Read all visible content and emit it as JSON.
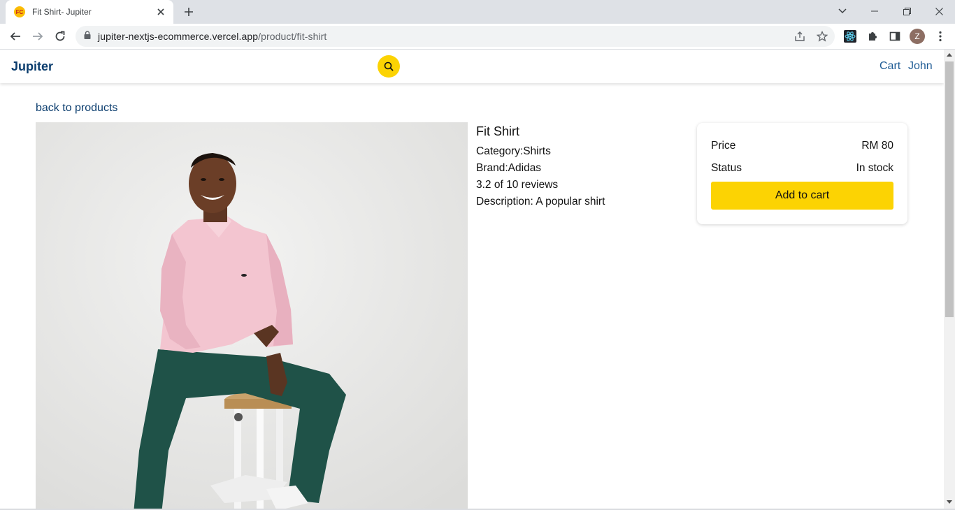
{
  "browser": {
    "tab": {
      "favicon_text": "FC",
      "title": "Fit Shirt- Jupiter"
    },
    "address": {
      "domain": "jupiter-nextjs-ecommerce.vercel.app",
      "path": "/product/fit-shirt"
    },
    "profile_initial": "Z"
  },
  "header": {
    "brand": "Jupiter",
    "cart_label": "Cart",
    "user_label": "John"
  },
  "product": {
    "back_label": "back to products",
    "name": "Fit Shirt",
    "category": "Category:Shirts",
    "brand": "Brand:Adidas",
    "reviews": "3.2 of 10 reviews",
    "description": "Description: A popular shirt"
  },
  "purchase": {
    "price_label": "Price",
    "price_value": "RM 80",
    "status_label": "Status",
    "status_value": "In stock",
    "add_label": "Add to cart"
  },
  "colors": {
    "accent": "#fcd303",
    "brand": "#0b3d6e",
    "link": "#1e5b94"
  }
}
